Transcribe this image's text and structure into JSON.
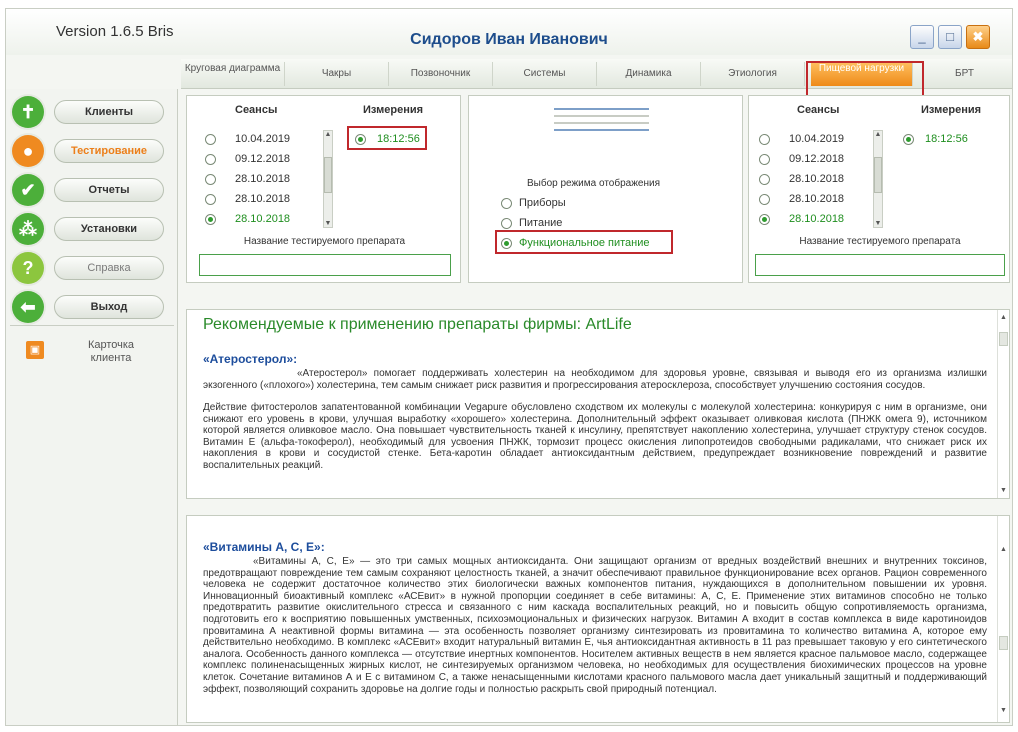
{
  "window": {
    "version": "Version 1.6.5 Bris",
    "user": "Сидоров Иван Иванович",
    "controls": {
      "minimize": "_",
      "restore": "□",
      "close": "✖"
    }
  },
  "tabs": [
    {
      "label": "Круговая диаграмма",
      "active": false
    },
    {
      "label": "Чакры",
      "active": false
    },
    {
      "label": "Позвоночник",
      "active": false
    },
    {
      "label": "Системы",
      "active": false
    },
    {
      "label": "Динамика",
      "active": false
    },
    {
      "label": "Этиология",
      "active": false
    },
    {
      "label": "Пищевой нагрузки",
      "active": true
    },
    {
      "label": "БРТ",
      "active": false
    }
  ],
  "sidebar": {
    "items": [
      {
        "label": "Клиенты",
        "icon": "cross-icon",
        "color": "#4caf3a",
        "glyph": "✝",
        "active": false
      },
      {
        "label": "Тестирование",
        "icon": "person-icon",
        "color": "#ef8a20",
        "glyph": "●",
        "active": true
      },
      {
        "label": "Отчеты",
        "icon": "check-icon",
        "color": "#4caf3a",
        "glyph": "✔",
        "active": false
      },
      {
        "label": "Установки",
        "icon": "network-icon",
        "color": "#4caf3a",
        "glyph": "⁂",
        "active": false
      },
      {
        "label": "Справка",
        "icon": "question-icon",
        "color": "#8cc63e",
        "glyph": "?",
        "active": false
      },
      {
        "label": "Выход",
        "icon": "back-arrow-icon",
        "color": "#4caf3a",
        "glyph": "⬅",
        "active": false
      }
    ],
    "card_label": "Карточка клиента"
  },
  "left_panel": {
    "sessions_header": "Сеансы",
    "measurements_header": "Измерения",
    "sessions": [
      {
        "date": "10.04.2019",
        "selected": false
      },
      {
        "date": "09.12.2018",
        "selected": false
      },
      {
        "date": "28.10.2018",
        "selected": false
      },
      {
        "date": "28.10.2018",
        "selected": false
      },
      {
        "date": "28.10.2018",
        "selected": true
      }
    ],
    "measurements": [
      {
        "time": "18:12:56",
        "selected": true
      }
    ],
    "drug_label": "Название тестируемого препарата",
    "drug_value": ""
  },
  "center_panel": {
    "mode_label": "Выбор режима отображения",
    "modes": [
      {
        "label": "Приборы",
        "selected": false
      },
      {
        "label": "Питание",
        "selected": false
      },
      {
        "label": "Функциональное питание",
        "selected": true
      }
    ]
  },
  "right_panel": {
    "sessions_header": "Сеансы",
    "measurements_header": "Измерения",
    "sessions": [
      {
        "date": "10.04.2019",
        "selected": false
      },
      {
        "date": "09.12.2018",
        "selected": false
      },
      {
        "date": "28.10.2018",
        "selected": false
      },
      {
        "date": "28.10.2018",
        "selected": false
      },
      {
        "date": "28.10.2018",
        "selected": true
      }
    ],
    "measurements": [
      {
        "time": "18:12:56",
        "selected": true
      }
    ],
    "drug_label": "Название тестируемого препарата",
    "drug_value": ""
  },
  "recommend": {
    "title": "Рекомендуемые к применению препараты фирмы: ArtLife",
    "drug1": {
      "name": "«Атеростерол»:",
      "text1": "«Атеростерол» помогает поддерживать холестерин на необходимом для здоровья уровне, связывая и выводя его из организма излишки экзогенного («плохого») холестерина, тем самым снижает риск развития и прогрессирования атеросклероза, способствует улучшению состояния сосудов.",
      "text2": "Действие фитостеролов запатентованной комбинации Vegapure обусловлено сходством их молекулы с молекулой холестерина: конкурируя с ним в организме, они снижают его уровень в крови, улучшая выработку «хорошего» холестерина. Дополнительный эффект оказывает оливковая кислота (ПНЖК омега 9), источником которой является оливковое масло. Она повышает чувствительность тканей к инсулину, препятствует накоплению холестерина, улучшает структуру стенок сосудов. Витамин Е (альфа-токоферол), необходимый для усвоения ПНЖК, тормозит процесс окисления липопротеидов свободными радикалами, что снижает риск их накопления в крови и сосудистой стенке. Бета-каротин обладает антиоксидантным действием, предупреждает возникновение повреждений и развитие воспалительных реакций."
    },
    "drug2": {
      "name": "«Витамины А, С, Е»:",
      "text1": "«Витамины А, С, Е» — это три самых мощных антиоксиданта. Они защищают организм от вредных воздействий внешних и внутренних токсинов, предотвращают повреждение тем самым сохраняют целостность тканей, а значит обеспечивают правильное функционирование всех органов. Рацион современного человека не содержит достаточное количество этих биологически важных компонентов питания, нуждающихся в дополнительном повышении их уровня. Инновационный биоактивный комплекс «АСЕвит» в нужной пропорции соединяет в себе витамины: А, С, Е. Применение этих витаминов способно не только предотвратить развитие окислительного стресса и связанного с ним каскада воспалительных реакций, но и повысить общую сопротивляемость организма, подготовить его к восприятию повышенных умственных, психоэмоциональных и физических нагрузок. Витамин А входит в состав комплекса в виде каротиноидов провитамина А неактивной формы витамина — эта особенность позволяет организму синтезировать из провитамина то количество витамина А, которое ему действительно необходимо. В комплекс «АСЕвит» входит натуральный витамин Е, чья антиоксидантная активность в 11 раз превышает таковую у его синтетического аналога. Особенность данного комплекса — отсутствие инертных компонентов. Носителем активных веществ в нем является красное пальмовое масло, содержащее комплекс полиненасыщенных жирных кислот, не синтезируемых организмом человека, но необходимых для осуществления биохимических процессов на уровне клеток. Сочетание витаминов А и Е с витамином С, а также ненасыщенными кислотами красного пальмового масла дает уникальный защитный и поддерживающий эффект, позволяющий сохранить здоровье на долгие годы и полностью раскрыть свой природный потенциал."
    }
  },
  "colors": {
    "accent": "#ef8a20",
    "green": "#2e9b2e",
    "highlight": "#c0282c",
    "title_blue": "#1d4d8c"
  }
}
